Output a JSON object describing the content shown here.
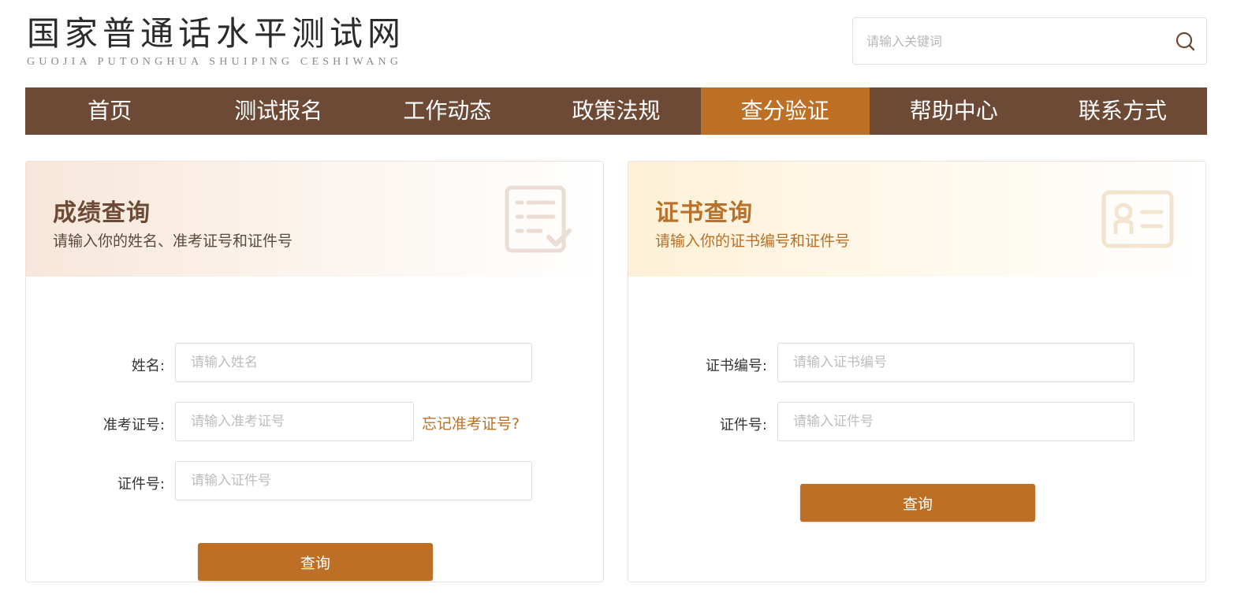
{
  "header": {
    "logo_title": "国家普通话水平测试网",
    "logo_subtitle": "GUOJIA PUTONGHUA SHUIPING CESHIWANG",
    "search_placeholder": "请输入关键词"
  },
  "nav": {
    "items": [
      {
        "label": "首页"
      },
      {
        "label": "测试报名"
      },
      {
        "label": "工作动态"
      },
      {
        "label": "政策法规"
      },
      {
        "label": "查分验证",
        "active": true
      },
      {
        "label": "帮助中心"
      },
      {
        "label": "联系方式"
      }
    ]
  },
  "score_query": {
    "title": "成绩查询",
    "description": "请输入你的姓名、准考证号和证件号",
    "name_label": "姓名:",
    "name_placeholder": "请输入姓名",
    "ticket_label": "准考证号:",
    "ticket_placeholder": "请输入准考证号",
    "forgot_ticket": "忘记准考证号?",
    "id_label": "证件号:",
    "id_placeholder": "请输入证件号",
    "submit_label": "查询"
  },
  "certificate_query": {
    "title": "证书查询",
    "description": "请输入你的证书编号和证件号",
    "cert_label": "证书编号:",
    "cert_placeholder": "请输入证书编号",
    "id_label": "证件号:",
    "id_placeholder": "请输入证件号",
    "submit_label": "查询"
  },
  "colors": {
    "nav_bg": "#6d4a36",
    "nav_active": "#bd6f26",
    "button": "#bd6f26",
    "accent_text": "#b8712a"
  },
  "icons": {
    "search": "search-icon",
    "score_deco": "checklist-document-icon",
    "cert_deco": "id-card-icon"
  }
}
